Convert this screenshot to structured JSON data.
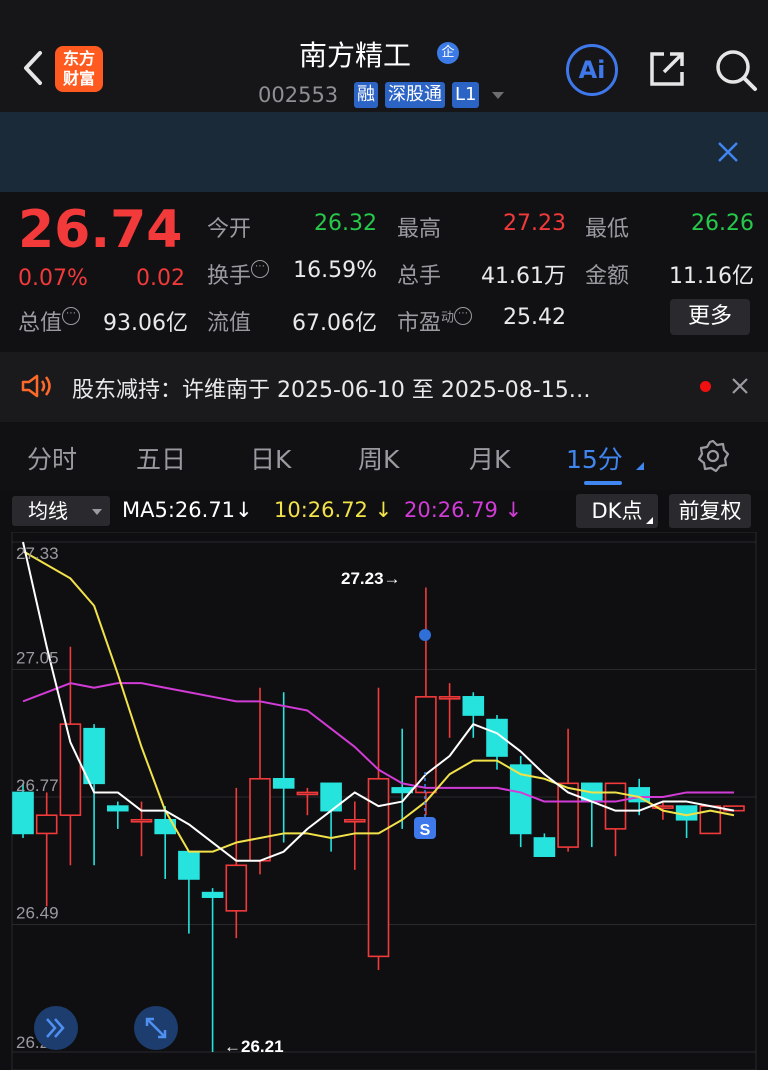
{
  "header": {
    "logo_text_line1": "东方",
    "logo_text_line2": "财富",
    "stock_name": "南方精工",
    "stock_name_badge": "企",
    "stock_code": "002553",
    "tags": [
      "融",
      "深股通",
      "L1"
    ],
    "ai_label": "Ai"
  },
  "quote": {
    "price": "26.74",
    "change_pct": "0.07%",
    "change_amt": "0.02",
    "rows": [
      [
        {
          "label": "今开",
          "value": "26.32",
          "color": "green"
        },
        {
          "label": "最高",
          "value": "27.23",
          "color": "red"
        },
        {
          "label": "最低",
          "value": "26.26",
          "color": "green"
        }
      ],
      [
        {
          "label": "换手",
          "value": "16.59%",
          "color": "white"
        },
        {
          "label": "总手",
          "value": "41.61万",
          "color": "white"
        },
        {
          "label": "金额",
          "value": "11.16亿",
          "color": "white"
        }
      ]
    ],
    "row3": {
      "total_cap_label": "总值",
      "total_cap_value": "93.06亿",
      "float_cap_label": "流值",
      "float_cap_value": "67.06亿",
      "pe_label": "市盈",
      "pe_sup": "动",
      "pe_value": "25.42",
      "more_button": "更多"
    }
  },
  "notice": {
    "text": "股东减持：许维南于 2025-06-10 至 2025-08-15…"
  },
  "tabs": [
    "分时",
    "五日",
    "日K",
    "周K",
    "月K",
    "15分"
  ],
  "ma_bar": {
    "type_select": "均线",
    "ma5": "MA5:26.71↓",
    "ma10": "10:26.72 ↓",
    "ma20": "20:26.79 ↓",
    "dk_button": "DK点",
    "adjust_button": "前复权"
  },
  "colors": {
    "up": "#f23a3a",
    "down": "#26e3de",
    "ma5": "#ffffff",
    "ma10": "#f2e24a",
    "ma20": "#d23cd6",
    "accent": "#3f86f0"
  },
  "chart_data": {
    "type": "candlestick",
    "y_ticks": [
      "27.33",
      "27.05",
      "26.77",
      "26.49",
      "26.21"
    ],
    "ylim": [
      26.21,
      27.33
    ],
    "high_annotation": "27.23→",
    "low_annotation": "←26.21",
    "sell_marker": "S",
    "candles": [
      {
        "o": 26.78,
        "h": 26.8,
        "l": 26.68,
        "c": 26.69
      },
      {
        "o": 26.69,
        "h": 26.78,
        "l": 26.53,
        "c": 26.73
      },
      {
        "o": 26.73,
        "h": 27.1,
        "l": 26.62,
        "c": 26.93
      },
      {
        "o": 26.92,
        "h": 26.93,
        "l": 26.62,
        "c": 26.8
      },
      {
        "o": 26.75,
        "h": 26.76,
        "l": 26.7,
        "c": 26.74
      },
      {
        "o": 26.72,
        "h": 26.76,
        "l": 26.64,
        "c": 26.72
      },
      {
        "o": 26.72,
        "h": 26.75,
        "l": 26.59,
        "c": 26.69
      },
      {
        "o": 26.65,
        "h": 26.65,
        "l": 26.47,
        "c": 26.59
      },
      {
        "o": 26.56,
        "h": 26.57,
        "l": 26.21,
        "c": 26.55
      },
      {
        "o": 26.52,
        "h": 26.79,
        "l": 26.46,
        "c": 26.62
      },
      {
        "o": 26.63,
        "h": 27.01,
        "l": 26.6,
        "c": 26.81
      },
      {
        "o": 26.81,
        "h": 27.0,
        "l": 26.67,
        "c": 26.79
      },
      {
        "o": 26.78,
        "h": 26.79,
        "l": 26.73,
        "c": 26.78
      },
      {
        "o": 26.8,
        "h": 26.8,
        "l": 26.65,
        "c": 26.74
      },
      {
        "o": 26.72,
        "h": 26.76,
        "l": 26.61,
        "c": 26.72
      },
      {
        "o": 26.42,
        "h": 27.01,
        "l": 26.39,
        "c": 26.81
      },
      {
        "o": 26.79,
        "h": 26.92,
        "l": 26.7,
        "c": 26.78
      },
      {
        "o": 26.78,
        "h": 27.23,
        "l": 26.73,
        "c": 26.99
      },
      {
        "o": 26.99,
        "h": 27.02,
        "l": 26.9,
        "c": 26.99
      },
      {
        "o": 26.99,
        "h": 27.0,
        "l": 26.9,
        "c": 26.95
      },
      {
        "o": 26.94,
        "h": 26.95,
        "l": 26.83,
        "c": 26.86
      },
      {
        "o": 26.84,
        "h": 26.86,
        "l": 26.66,
        "c": 26.69
      },
      {
        "o": 26.68,
        "h": 26.69,
        "l": 26.64,
        "c": 26.64
      },
      {
        "o": 26.66,
        "h": 26.92,
        "l": 26.65,
        "c": 26.8
      },
      {
        "o": 26.8,
        "h": 26.8,
        "l": 26.66,
        "c": 26.76
      },
      {
        "o": 26.7,
        "h": 26.8,
        "l": 26.64,
        "c": 26.8
      },
      {
        "o": 26.79,
        "h": 26.81,
        "l": 26.73,
        "c": 26.76
      },
      {
        "o": 26.75,
        "h": 26.76,
        "l": 26.72,
        "c": 26.75
      },
      {
        "o": 26.75,
        "h": 26.75,
        "l": 26.68,
        "c": 26.72
      },
      {
        "o": 26.69,
        "h": 26.75,
        "l": 26.69,
        "c": 26.75
      },
      {
        "o": 26.74,
        "h": 26.75,
        "l": 26.74,
        "c": 26.75
      }
    ],
    "ma5": [
      27.33,
      27.1,
      26.89,
      26.78,
      26.78,
      26.74,
      26.74,
      26.71,
      26.67,
      26.63,
      26.63,
      26.65,
      26.7,
      26.74,
      26.78,
      26.75,
      26.76,
      26.82,
      26.86,
      26.93,
      26.91,
      26.87,
      26.82,
      26.78,
      26.76,
      26.74,
      26.74,
      26.76,
      26.76,
      26.75,
      26.74
    ],
    "ma10": [
      27.31,
      27.28,
      27.25,
      27.19,
      27.04,
      26.88,
      26.74,
      26.65,
      26.65,
      26.67,
      26.68,
      26.69,
      26.69,
      26.68,
      26.69,
      26.69,
      26.72,
      26.76,
      26.82,
      26.85,
      26.85,
      26.82,
      26.81,
      26.79,
      26.78,
      26.78,
      26.77,
      26.74,
      26.73,
      26.74,
      26.73
    ],
    "ma20": [
      26.98,
      27.0,
      27.02,
      27.01,
      27.02,
      27.02,
      27.01,
      27.0,
      26.99,
      26.98,
      26.98,
      26.97,
      26.96,
      26.92,
      26.88,
      26.83,
      26.8,
      26.79,
      26.79,
      26.79,
      26.79,
      26.78,
      26.76,
      26.76,
      26.76,
      26.76,
      26.77,
      26.77,
      26.78,
      26.78,
      26.78
    ]
  }
}
